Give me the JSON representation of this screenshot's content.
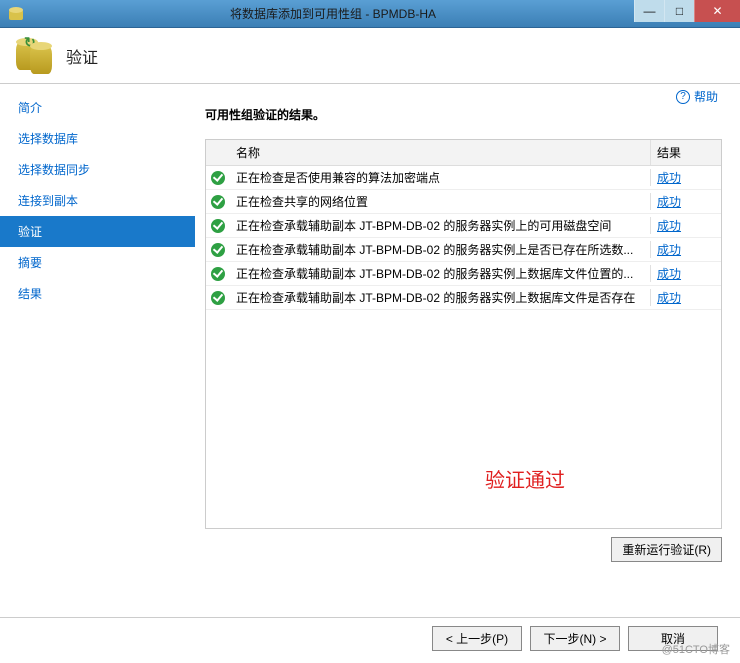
{
  "window": {
    "title": "将数据库添加到可用性组 - BPMDB-HA"
  },
  "header": {
    "title": "验证"
  },
  "help": {
    "label": "帮助"
  },
  "sidebar": {
    "items": [
      {
        "label": "简介"
      },
      {
        "label": "选择数据库"
      },
      {
        "label": "选择数据同步"
      },
      {
        "label": "连接到副本"
      },
      {
        "label": "验证"
      },
      {
        "label": "摘要"
      },
      {
        "label": "结果"
      }
    ],
    "selected_index": 4
  },
  "main": {
    "heading": "可用性组验证的结果。",
    "columns": {
      "name": "名称",
      "result": "结果"
    },
    "rows": [
      {
        "name": "正在检查是否使用兼容的算法加密端点",
        "result": "成功"
      },
      {
        "name": "正在检查共享的网络位置",
        "result": "成功"
      },
      {
        "name": "正在检查承载辅助副本 JT-BPM-DB-02 的服务器实例上的可用磁盘空间",
        "result": "成功"
      },
      {
        "name": "正在检查承载辅助副本 JT-BPM-DB-02 的服务器实例上是否已存在所选数...",
        "result": "成功"
      },
      {
        "name": "正在检查承载辅助副本 JT-BPM-DB-02 的服务器实例上数据库文件位置的...",
        "result": "成功"
      },
      {
        "name": "正在检查承载辅助副本 JT-BPM-DB-02 的服务器实例上数据库文件是否存在",
        "result": "成功"
      }
    ],
    "annotation": "验证通过",
    "rerun_label": "重新运行验证(R)"
  },
  "footer": {
    "back": "< 上一步(P)",
    "next": "下一步(N) >",
    "cancel": "取消"
  },
  "watermark": "@51CTO博客"
}
